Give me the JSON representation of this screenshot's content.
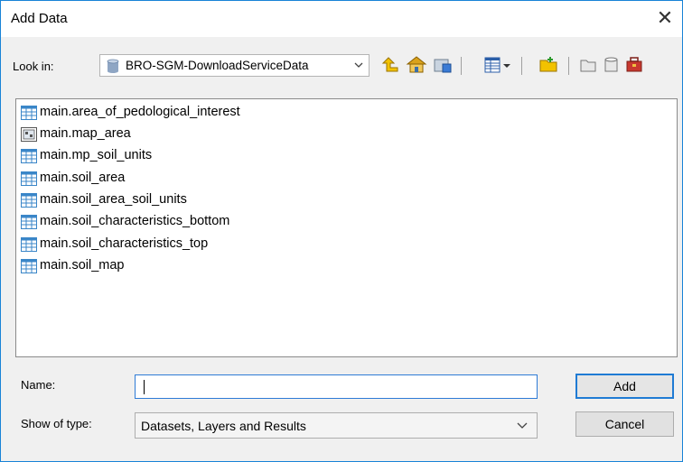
{
  "window": {
    "title": "Add Data",
    "close_glyph": "✕"
  },
  "look_in": {
    "label": "Look in:",
    "value": "BRO-SGM-DownloadServiceData"
  },
  "toolbar": {
    "icons": [
      "up-one-level-icon",
      "home-icon",
      "connect-folder-icon",
      "view-details-icon",
      "view-menu-dropdown-icon",
      "new-folder-icon",
      "new-file-geodatabase-icon",
      "new-personal-geodatabase-icon",
      "new-toolbox-icon"
    ]
  },
  "items": [
    {
      "label": "main.area_of_pedological_interest",
      "icon": "table-icon"
    },
    {
      "label": "main.map_area",
      "icon": "raster-table-icon"
    },
    {
      "label": "main.mp_soil_units",
      "icon": "table-icon"
    },
    {
      "label": "main.soil_area",
      "icon": "table-icon"
    },
    {
      "label": "main.soil_area_soil_units",
      "icon": "table-icon"
    },
    {
      "label": "main.soil_characteristics_bottom",
      "icon": "table-icon"
    },
    {
      "label": "main.soil_characteristics_top",
      "icon": "table-icon"
    },
    {
      "label": "main.soil_map",
      "icon": "table-icon"
    }
  ],
  "name": {
    "label": "Name:",
    "value": ""
  },
  "show_type": {
    "label": "Show of type:",
    "value": "Datasets, Layers and Results"
  },
  "buttons": {
    "add": "Add",
    "cancel": "Cancel"
  },
  "colors": {
    "accent": "#1f7bd4",
    "table_icon_blue": "#3a86c8"
  }
}
